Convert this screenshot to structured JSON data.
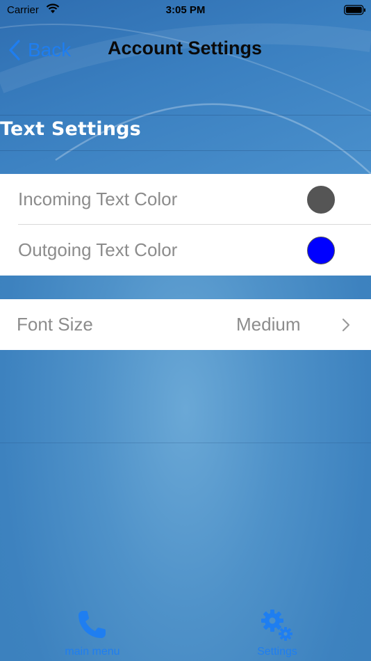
{
  "status_bar": {
    "carrier": "Carrier",
    "time": "3:05 PM"
  },
  "nav": {
    "back_label": "Back",
    "title": "Account Settings"
  },
  "section": {
    "header": "Text Settings"
  },
  "color_rows": [
    {
      "label": "Incoming Text Color",
      "color": "#555555"
    },
    {
      "label": "Outgoing Text Color",
      "color": "#0000ff"
    }
  ],
  "font_row": {
    "label": "Font Size",
    "value": "Medium"
  },
  "tab_bar": {
    "tabs": [
      {
        "label": "main menu",
        "icon": "phone-icon"
      },
      {
        "label": "Settings",
        "icon": "gear-icon"
      }
    ]
  },
  "colors": {
    "accent": "#1f7ef0",
    "background": "#3d82bf"
  }
}
